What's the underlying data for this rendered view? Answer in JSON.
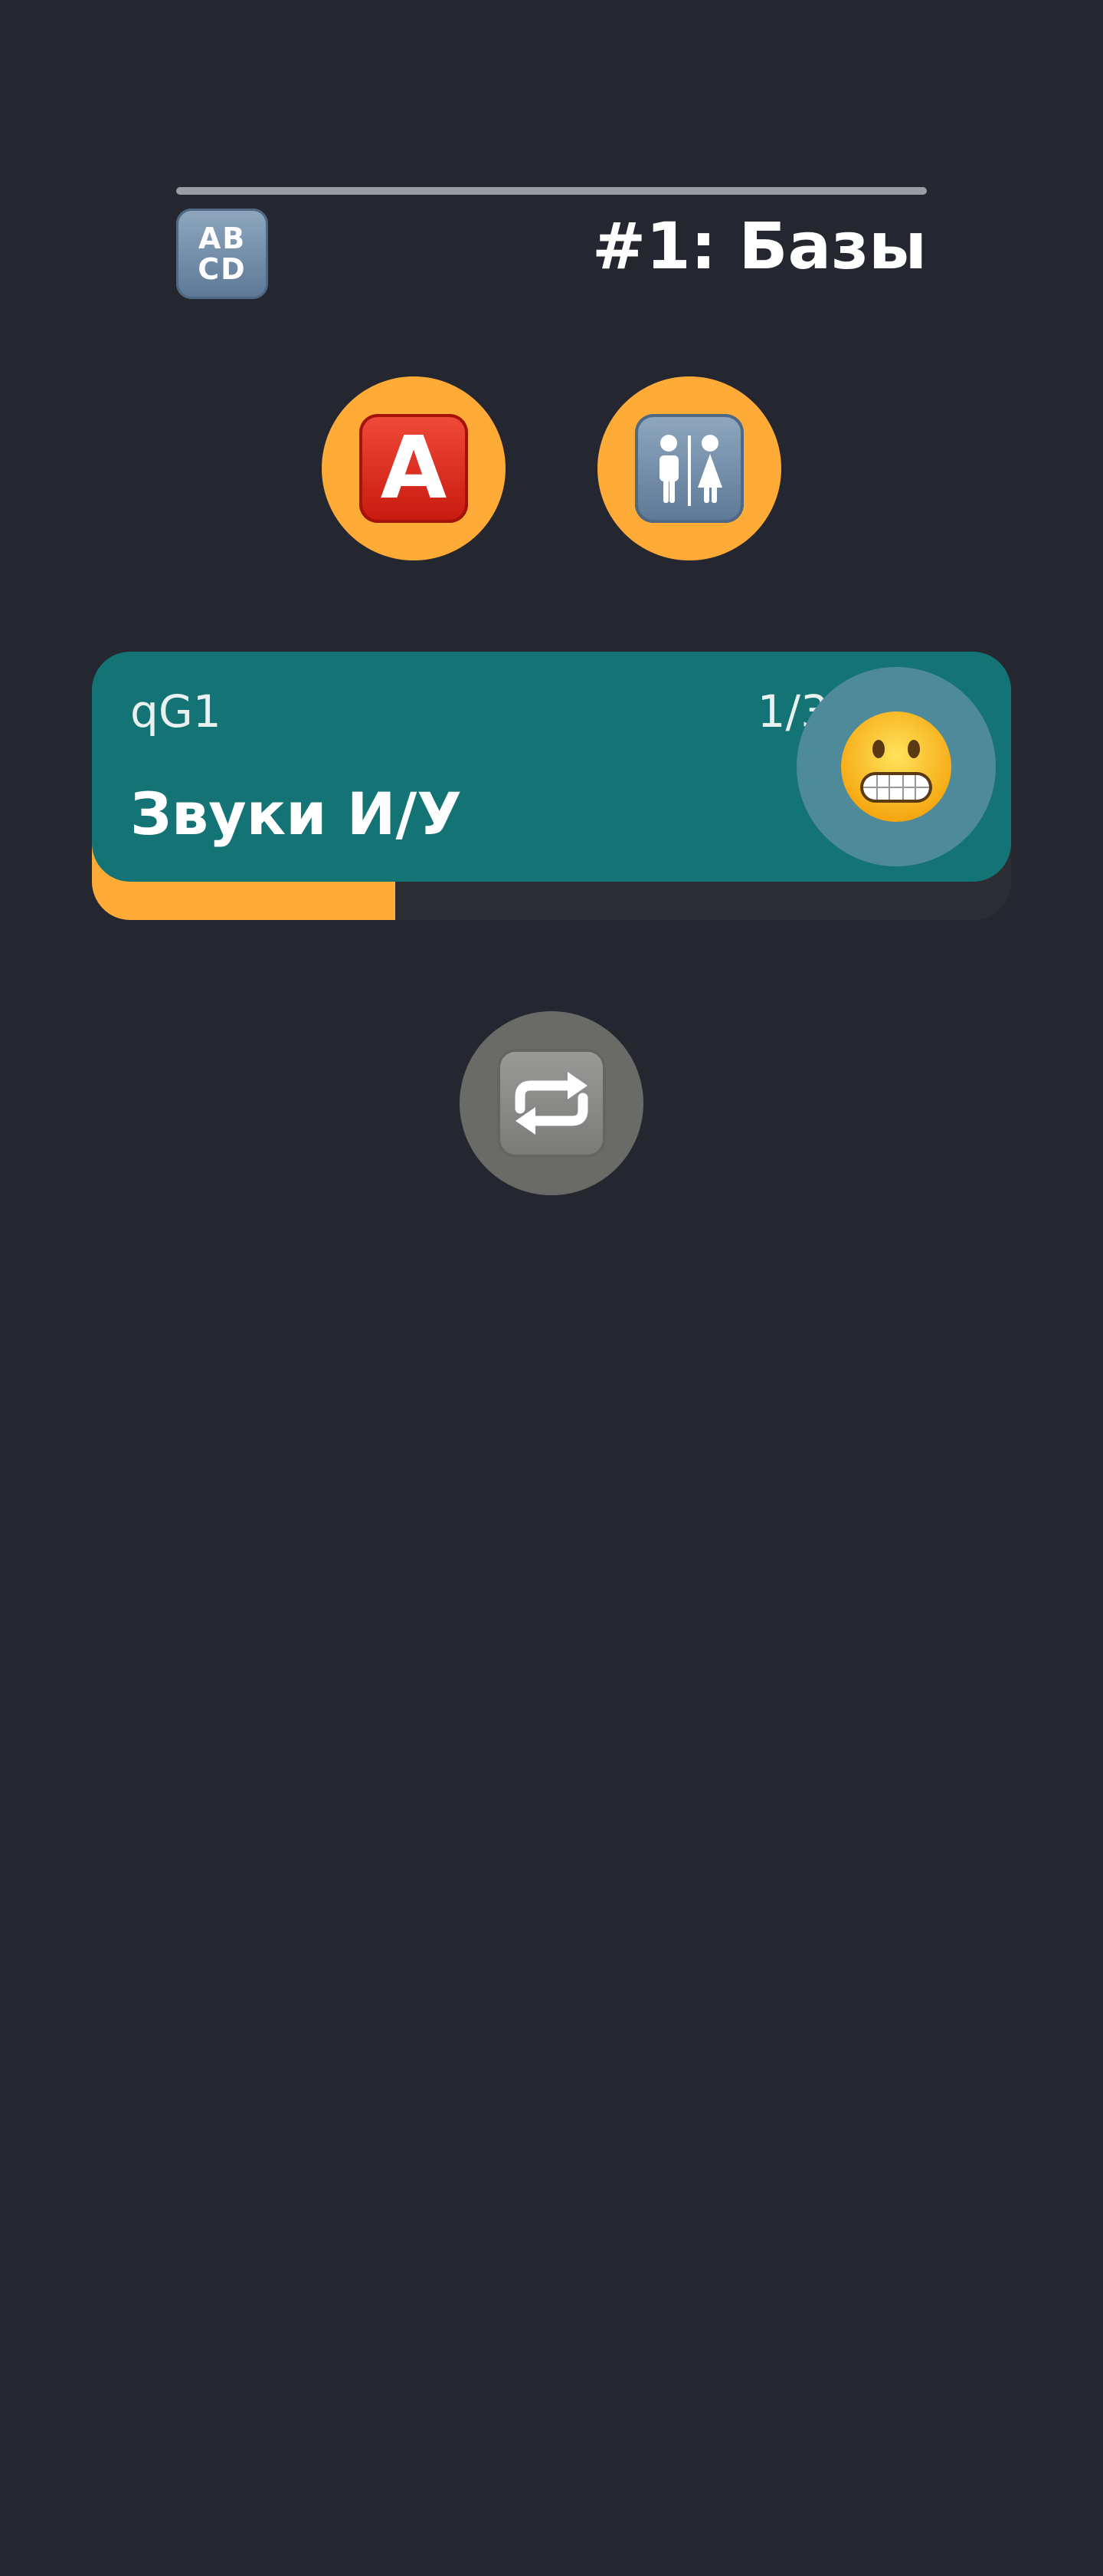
{
  "header": {
    "abcd_icon": {
      "line1": "AB",
      "line2": "CD",
      "icon": "input-latin-uppercase-icon"
    },
    "title": "#1: Базы"
  },
  "options": [
    {
      "icon": "a-button-icon",
      "label": "A",
      "color": "#c8190f"
    },
    {
      "icon": "restroom-icon",
      "color": "#5d7896"
    }
  ],
  "card": {
    "code": "qG1",
    "count": "1/3",
    "title": "Звуки И/У",
    "emoji_icon": "grimacing-face-icon",
    "progress": 0.33,
    "colors": {
      "card": "#137375",
      "progress": "#ffab38"
    }
  },
  "repeat": {
    "icon": "repeat-icon"
  },
  "colors": {
    "background": "#252730",
    "accent": "#ffab38"
  }
}
